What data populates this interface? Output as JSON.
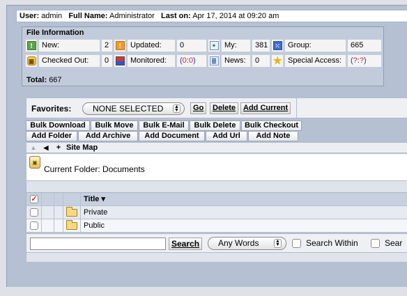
{
  "user": {
    "user_label": "User:",
    "user_value": "admin",
    "fullname_label": "Full Name:",
    "fullname_value": "Administrator",
    "laston_label": "Last on:",
    "laston_value": "Apr 17, 2014 at 09:20 am"
  },
  "file_info": {
    "title": "File Information",
    "new_label": "New:",
    "new_value": "2",
    "updated_label": "Updated:",
    "updated_value": "0",
    "my_label": "My:",
    "my_value": "381",
    "group_label": "Group:",
    "group_value": "665",
    "checkedout_label": "Checked Out:",
    "checkedout_value": "0",
    "monitored_label": "Monitored:",
    "monitored_open": "(",
    "monitored_a": "0",
    "monitored_sep": ":",
    "monitored_b": "0",
    "monitored_close": ")",
    "news_label": "News:",
    "news_value": "0",
    "special_label": "Special Access:",
    "special_open": "(",
    "special_a": "?",
    "special_sep": ":",
    "special_b": "?",
    "special_close": ")",
    "total_label": "Total:",
    "total_value": "667"
  },
  "favorites": {
    "label": "Favorites:",
    "selected": "NONE SELECTED",
    "go": "Go",
    "delete": "Delete",
    "add_current": "Add Current"
  },
  "bulk_buttons": [
    "Bulk Download",
    "Bulk Move",
    "Bulk E-Mail",
    "Bulk Delete",
    "Bulk Checkout"
  ],
  "add_buttons": [
    "Add Folder",
    "Add Archive",
    "Add Document",
    "Add Url",
    "Add Note"
  ],
  "nav": {
    "up": "▲",
    "back": "◀",
    "add": "+",
    "sitemap": "Site Map"
  },
  "folder": {
    "label": "Current Folder:",
    "name": "Documents"
  },
  "list": {
    "title_header": "Title ▾",
    "rows": [
      "Private",
      "Public"
    ]
  },
  "search": {
    "button": "Search",
    "mode": "Any Words",
    "within_label": "Search Within",
    "next_label": "Sear"
  },
  "colors": {
    "frame": "#b5c0d3",
    "link_blue": "#2230c9",
    "checked_red": "#d12a2a"
  }
}
